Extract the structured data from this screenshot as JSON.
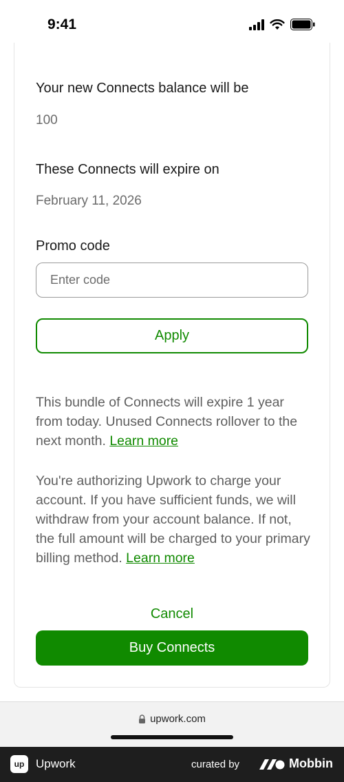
{
  "status_bar": {
    "time": "9:41"
  },
  "balance": {
    "label": "Your new Connects balance will be",
    "value": "100"
  },
  "expiry": {
    "label": "These Connects will expire on",
    "value": "February 11, 2026"
  },
  "promo": {
    "label": "Promo code",
    "placeholder": "Enter code",
    "value": "",
    "apply_label": "Apply"
  },
  "info": {
    "bundle_text": "This bundle of Connects will expire 1 year from today. Unused Connects rollover to the next month.",
    "bundle_link": "Learn more",
    "auth_text": "You're authorizing Upwork to charge your account. If you have sufficient funds, we will withdraw from your account balance. If not, the full amount will be charged to your primary billing method.",
    "auth_link": "Learn more"
  },
  "actions": {
    "cancel_label": "Cancel",
    "buy_label": "Buy Connects"
  },
  "browser": {
    "url": "upwork.com"
  },
  "footer": {
    "logo_text": "up",
    "app_name": "Upwork",
    "curated_by": "curated by",
    "brand": "Mobbin"
  },
  "colors": {
    "accent": "#108a00",
    "text": "#181818",
    "muted": "#6b6b6b",
    "footer_bg": "#1e1e1e"
  }
}
